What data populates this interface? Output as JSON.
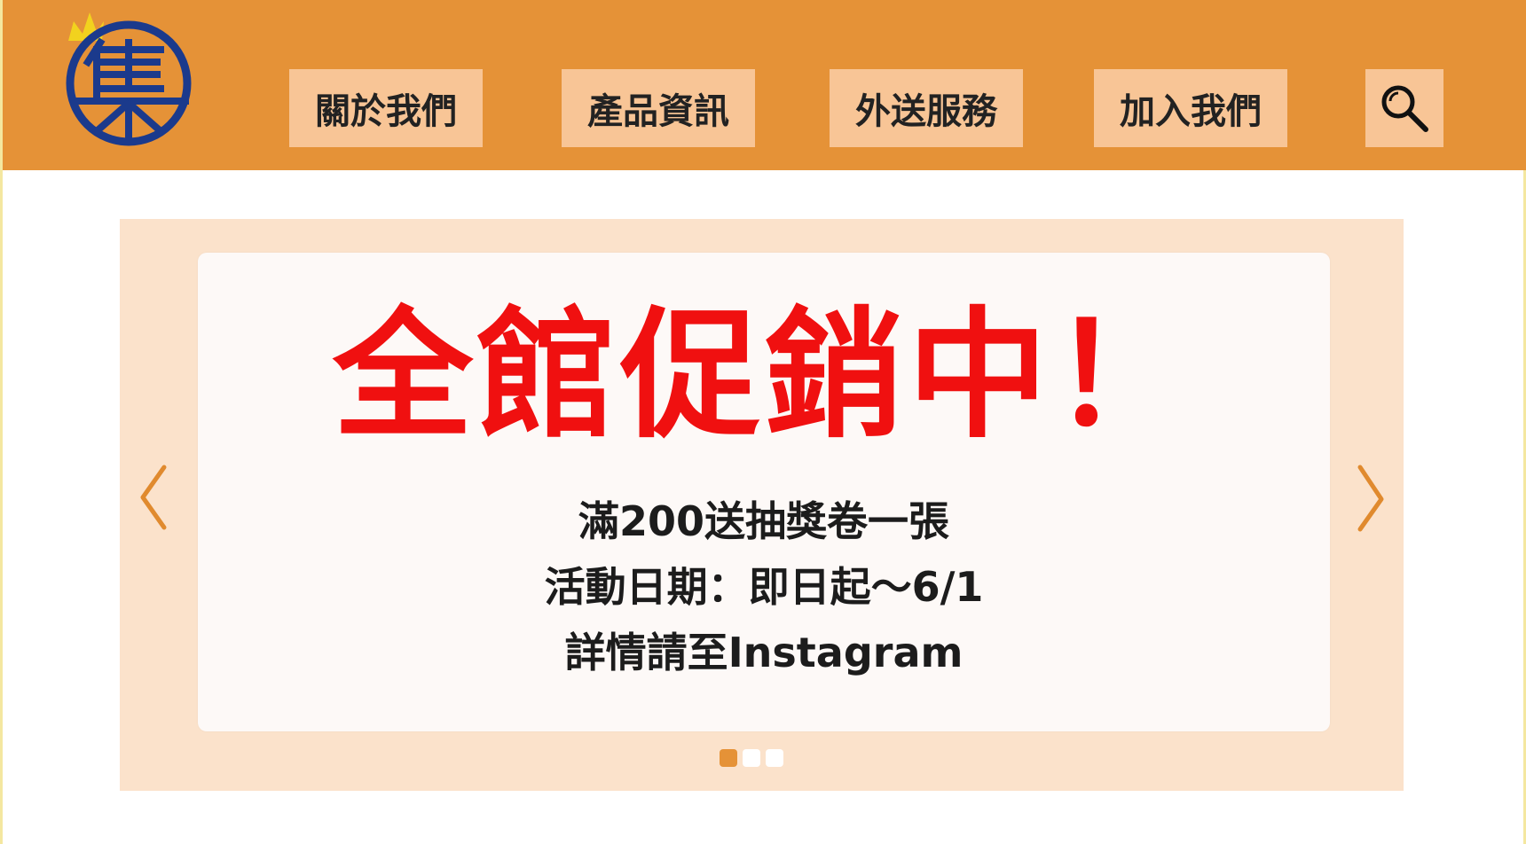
{
  "header": {
    "logo_alt": "集",
    "nav": [
      {
        "label": "關於我們"
      },
      {
        "label": "產品資訊"
      },
      {
        "label": "外送服務"
      },
      {
        "label": "加入我們"
      }
    ],
    "search_icon": "search-icon"
  },
  "carousel": {
    "title": "全館促銷中！",
    "lines": [
      "滿200送抽獎卷一張",
      "活動日期：即日起～6/1",
      "詳情請至Instagram"
    ],
    "prev_icon": "chevron-left-icon",
    "next_icon": "chevron-right-icon",
    "slide_count": 3,
    "active_slide": 1
  },
  "colors": {
    "header_bg": "#e59237",
    "nav_button_bg": "#f8c596",
    "carousel_bg": "#fbe2cb",
    "promo_title": "#f01010",
    "logo_blue": "#1b3a8c",
    "crown_yellow": "#f2d21e"
  }
}
